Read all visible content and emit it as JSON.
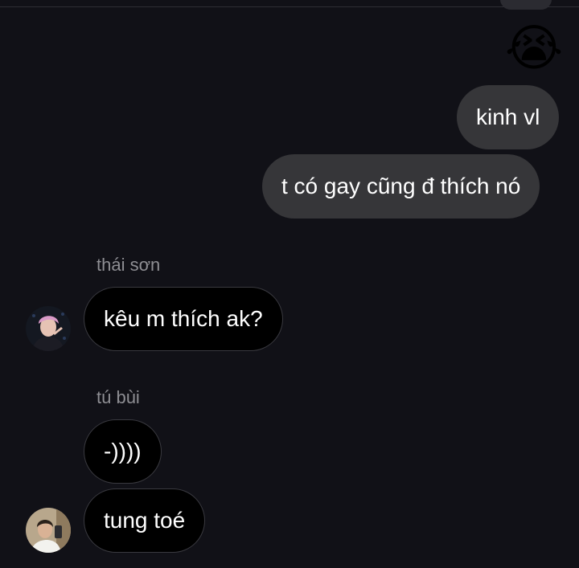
{
  "chat": {
    "reaction_emoji": "😭",
    "messages_sent": [
      {
        "text": "kinh vl"
      },
      {
        "text": "t có gay cũng đ thích nó"
      }
    ],
    "groups": [
      {
        "sender": "thái sơn",
        "avatar_icon": "person-photo-pink-hair",
        "messages": [
          {
            "text": "kêu m thích ak?"
          }
        ]
      },
      {
        "sender": "tú bùi",
        "avatar_icon": "person-photo-selfie",
        "messages": [
          {
            "text": "-))))"
          },
          {
            "text": "tung toé"
          }
        ]
      }
    ]
  },
  "colors": {
    "background": "#111117",
    "sent_bubble": "#363639",
    "received_bubble": "#000000",
    "received_border": "#3a3a40",
    "sender_name": "#8e8e93",
    "text": "#ffffff"
  }
}
